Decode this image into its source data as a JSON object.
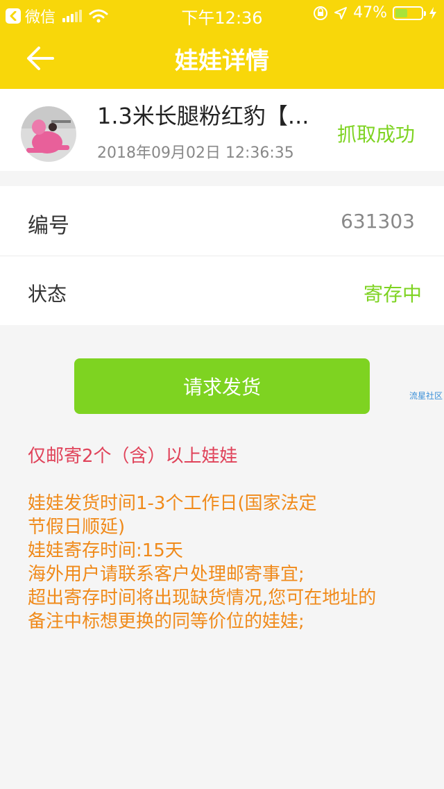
{
  "status_bar": {
    "carrier": "微信",
    "time": "下午12:36",
    "battery": "47%",
    "battery_level": 0.47
  },
  "nav": {
    "title": "娃娃详情"
  },
  "product": {
    "name": "1.3米长腿粉红豹【...",
    "timestamp": "2018年09月02日 12:36:35",
    "status": "抓取成功"
  },
  "info": {
    "id_label": "编号",
    "id_value": "631303",
    "state_label": "状态",
    "state_value": "寄存中"
  },
  "actions": {
    "ship_label": "请求发货"
  },
  "watermark": "流星社区",
  "notes": {
    "red": "仅邮寄2个（含）以上娃娃",
    "lines": [
      "娃娃发货时间1-3个工作日(国家法定",
      "节假日顺延)",
      "娃娃寄存时间:15天",
      "海外用户请联系客户处理邮寄事宜;",
      "超出寄存时间将出现缺货情况,您可在地址的",
      "备注中标想更换的同等价位的娃娃;"
    ]
  },
  "colors": {
    "header": "#f8d70a",
    "green": "#7ed321",
    "red_note": "#e0435a",
    "orange_note": "#f08a1a"
  }
}
